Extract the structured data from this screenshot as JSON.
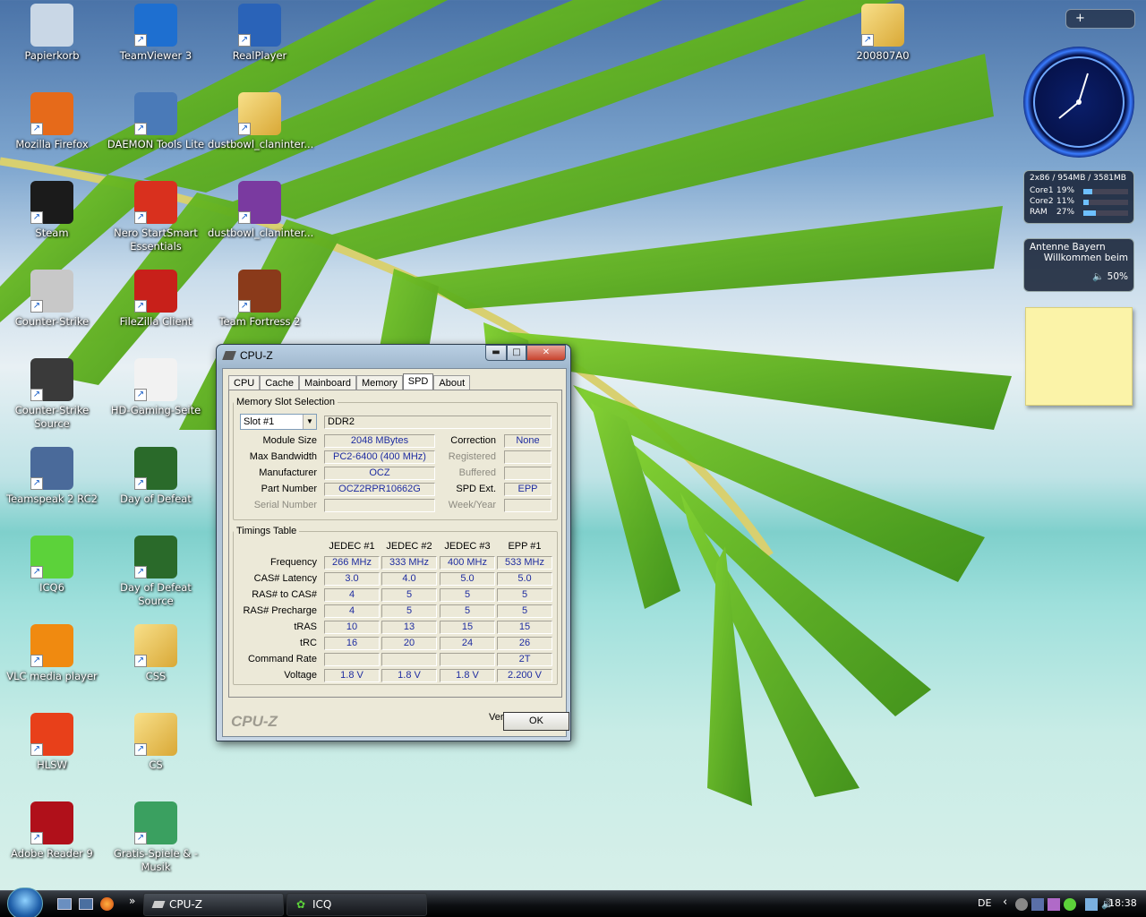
{
  "desktop": {
    "icons": [
      {
        "label": "Papierkorb",
        "icon": "recycle-bin-icon"
      },
      {
        "label": "TeamViewer 3",
        "icon": "teamviewer-icon"
      },
      {
        "label": "RealPlayer",
        "icon": "realplayer-icon"
      },
      {
        "label": "Mozilla Firefox",
        "icon": "firefox-icon"
      },
      {
        "label": "DAEMON Tools Lite",
        "icon": "daemon-tools-icon"
      },
      {
        "label": "dustbowl_claninter...",
        "icon": "folder-icon"
      },
      {
        "label": "Steam",
        "icon": "steam-icon"
      },
      {
        "label": "Nero StartSmart Essentials",
        "icon": "nero-icon"
      },
      {
        "label": "dustbowl_claninter...",
        "icon": "winrar-archive-icon"
      },
      {
        "label": "Counter-Strike",
        "icon": "counter-strike-icon"
      },
      {
        "label": "FileZilla Client",
        "icon": "filezilla-icon"
      },
      {
        "label": "Team Fortress 2",
        "icon": "team-fortress-icon"
      },
      {
        "label": "Counter-Strike Source",
        "icon": "counter-strike-source-icon"
      },
      {
        "label": "HD-Gaming-Seite",
        "icon": "document-icon"
      },
      {
        "label": "Teamspeak 2 RC2",
        "icon": "teamspeak-icon"
      },
      {
        "label": "Day of Defeat",
        "icon": "day-of-defeat-icon"
      },
      {
        "label": "ICQ6",
        "icon": "icq-icon"
      },
      {
        "label": "Day of Defeat Source",
        "icon": "day-of-defeat-source-icon"
      },
      {
        "label": "VLC media player",
        "icon": "vlc-icon"
      },
      {
        "label": "CSS",
        "icon": "folder-icon"
      },
      {
        "label": "HLSW",
        "icon": "hlsw-icon"
      },
      {
        "label": "CS",
        "icon": "folder-icon"
      },
      {
        "label": "Adobe Reader 9",
        "icon": "adobe-reader-icon"
      },
      {
        "label": "Gratis-Spiele & -Musik",
        "icon": "gift-icon"
      },
      {
        "label": "200807A0",
        "icon": "folder-icon"
      }
    ]
  },
  "sidebar": {
    "cpu_meter": {
      "header": "2x86 / 954MB / 3581MB",
      "rows": [
        {
          "name": "Core1",
          "value": "19%",
          "fraction": 0.19
        },
        {
          "name": "Core2",
          "value": "11%",
          "fraction": 0.11
        },
        {
          "name": "RAM",
          "value": "27%",
          "fraction": 0.27
        }
      ]
    },
    "radio": {
      "station": "Antenne Bayern",
      "message": "Willkommen beim",
      "volume": "50%"
    }
  },
  "cpuz": {
    "window_title": "CPU-Z",
    "tabs": [
      "CPU",
      "Cache",
      "Mainboard",
      "Memory",
      "SPD",
      "About"
    ],
    "active_tab": "SPD",
    "slot_group": "Memory Slot Selection",
    "slot": "Slot #1",
    "mem_type": "DDR2",
    "labels": {
      "module_size": "Module Size",
      "max_bandwidth": "Max Bandwidth",
      "manufacturer": "Manufacturer",
      "part_number": "Part Number",
      "serial_number": "Serial Number",
      "correction": "Correction",
      "registered": "Registered",
      "buffered": "Buffered",
      "spd_ext": "SPD Ext.",
      "week_year": "Week/Year"
    },
    "values": {
      "module_size": "2048 MBytes",
      "max_bandwidth": "PC2-6400 (400 MHz)",
      "manufacturer": "OCZ",
      "part_number": "OCZ2RPR10662G",
      "serial_number": "",
      "correction": "None",
      "registered": "",
      "buffered": "",
      "spd_ext": "EPP",
      "week_year": ""
    },
    "timings": {
      "group": "Timings Table",
      "columns": [
        "JEDEC #1",
        "JEDEC #2",
        "JEDEC #3",
        "EPP #1"
      ],
      "rows": [
        {
          "label": "Frequency",
          "cells": [
            "266 MHz",
            "333 MHz",
            "400 MHz",
            "533 MHz"
          ]
        },
        {
          "label": "CAS# Latency",
          "cells": [
            "3.0",
            "4.0",
            "5.0",
            "5.0"
          ]
        },
        {
          "label": "RAS# to CAS#",
          "cells": [
            "4",
            "5",
            "5",
            "5"
          ]
        },
        {
          "label": "RAS# Precharge",
          "cells": [
            "4",
            "5",
            "5",
            "5"
          ]
        },
        {
          "label": "tRAS",
          "cells": [
            "10",
            "13",
            "15",
            "15"
          ]
        },
        {
          "label": "tRC",
          "cells": [
            "16",
            "20",
            "24",
            "26"
          ]
        },
        {
          "label": "Command Rate",
          "cells": [
            "",
            "",
            "",
            "2T"
          ]
        },
        {
          "label": "Voltage",
          "cells": [
            "1.8 V",
            "1.8 V",
            "1.8 V",
            "2.200 V"
          ]
        }
      ]
    },
    "version": "Version 1.46",
    "brand": "CPU-Z",
    "ok_label": "OK"
  },
  "taskbar": {
    "buttons": [
      "CPU-Z",
      "ICQ"
    ],
    "language": "DE",
    "clock": "18:38"
  },
  "colors": {
    "value_text": "#1e2ca0",
    "taskbar": "#0d0f12",
    "sticky_note": "#fbf3a8"
  }
}
